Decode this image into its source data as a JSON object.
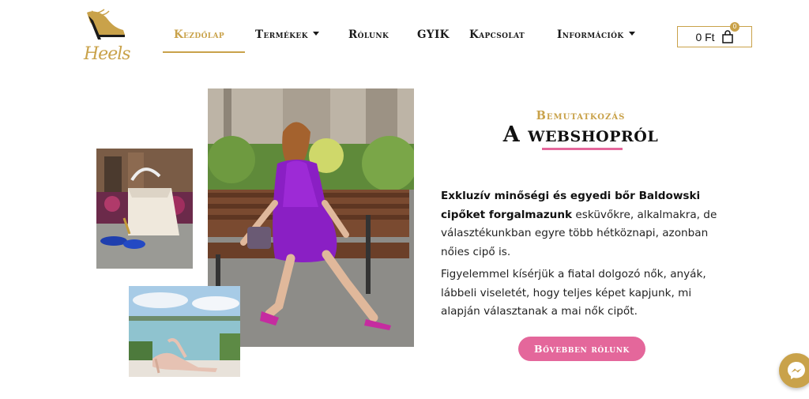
{
  "brand": {
    "logo_text": "Heels",
    "logo_icon": "high-heel-shoe-icon",
    "accent_color": "#c9a24a",
    "cta_color": "#e4679b"
  },
  "nav": {
    "items": [
      {
        "label": "Kezdőlap",
        "active": true
      },
      {
        "label": "Termékek",
        "dropdown": true
      },
      {
        "label": "Rólunk"
      },
      {
        "label": "GYIK"
      },
      {
        "label": "Kapcsolat"
      },
      {
        "label": "Információk",
        "dropdown": true
      }
    ]
  },
  "cart": {
    "total": "0 Ft",
    "count": "0",
    "icon": "shopping-bag-icon"
  },
  "about": {
    "eyebrow": "Bemutatkozás",
    "headline": "A webshopról",
    "para1_bold": "Exkluzív minőségi és egyedi bőr Baldowski cipőket forgalmazunk",
    "para1_rest": " esküvőkre, alkalmakra, de választékunkban egyre több hétköznapi, azonban nőies cipő is.",
    "para2": "Figyelemmel kísérjük a fiatal dolgozó nők, anyák, lábbeli viseletét, hogy teljes képet kapjunk, mi alapján választanak a mai nők cipőt.",
    "cta": "Bővebben rólunk"
  },
  "images": [
    {
      "name": "handbag-and-blue-shoes-photo"
    },
    {
      "name": "woman-purple-dress-bench-photo"
    },
    {
      "name": "nude-heels-lake-photo"
    }
  ],
  "chat": {
    "icon": "messenger-icon"
  }
}
